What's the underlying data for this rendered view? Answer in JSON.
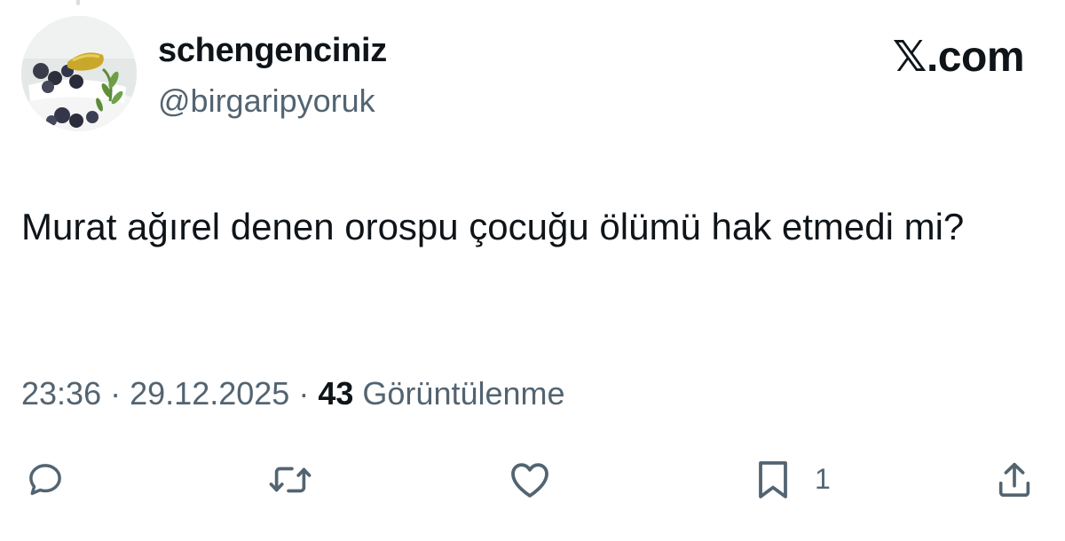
{
  "author": {
    "display_name": "schengenciniz",
    "handle": "@birgaripyoruk"
  },
  "brand": {
    "label": "𝕏.com"
  },
  "tweet": {
    "text": "Murat ağırel denen orospu çocuğu ölümü hak etmedi mi?"
  },
  "meta": {
    "time": "23:36",
    "separator": "·",
    "date": "29.12.2025",
    "views_count": "43",
    "views_label": "Görüntülenme"
  },
  "actions": {
    "reply_icon": "speech-bubble-icon",
    "retweet_icon": "repost-arrows-icon",
    "like_icon": "heart-icon",
    "bookmark_icon": "bookmark-icon",
    "bookmark_count": "1",
    "share_icon": "share-upload-icon"
  },
  "colors": {
    "text_primary": "#0f1419",
    "text_secondary": "#536471",
    "background": "#ffffff"
  }
}
